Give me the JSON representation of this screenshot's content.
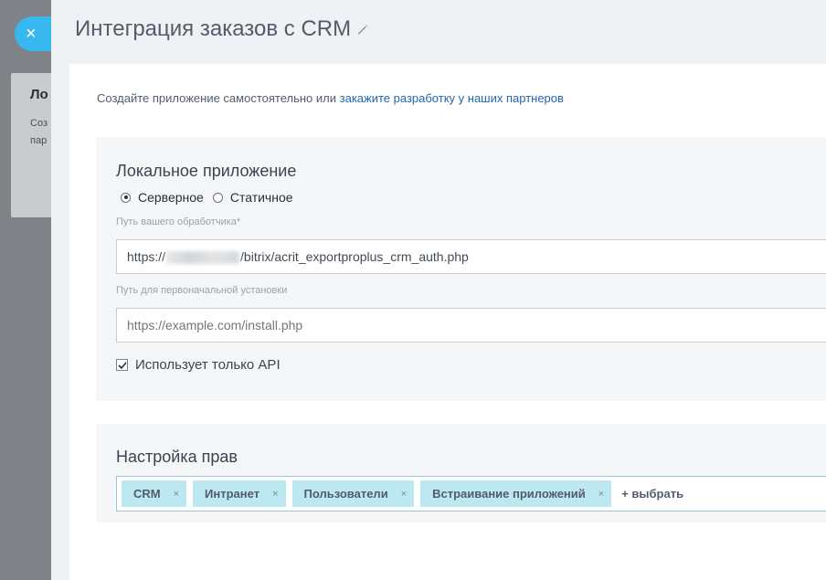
{
  "background": {
    "card_title": "Ло",
    "card_line1": "Соз",
    "card_line2": "пар"
  },
  "close_button": {
    "icon": "close-icon",
    "label": "×"
  },
  "header": {
    "title": "Интеграция заказов с CRM",
    "edit_icon": "pencil-icon"
  },
  "intro": {
    "text": "Создайте приложение самостоятельно или ",
    "link": "закажите разработку у наших партнеров"
  },
  "local_app": {
    "title": "Локальное приложение",
    "radio_server": "Серверное",
    "radio_static": "Статичное",
    "selected": "server",
    "handler_label": "Путь вашего обработчика*",
    "handler_prefix": "https://",
    "handler_suffix": "/bitrix/acrit_exportproplus_crm_auth.php",
    "install_label": "Путь для первоначальной установки",
    "install_placeholder": "https://example.com/install.php",
    "api_only_label": "Использует только API",
    "api_only_checked": true
  },
  "permissions": {
    "title": "Настройка прав",
    "tags": [
      "CRM",
      "Интранет",
      "Пользователи",
      "Встраивание приложений"
    ],
    "remove_symbol": "×",
    "add_label": "+ выбрать"
  },
  "colors": {
    "accent": "#37b9f0",
    "link": "#2067b0",
    "tag_bg": "#bce8f1"
  }
}
